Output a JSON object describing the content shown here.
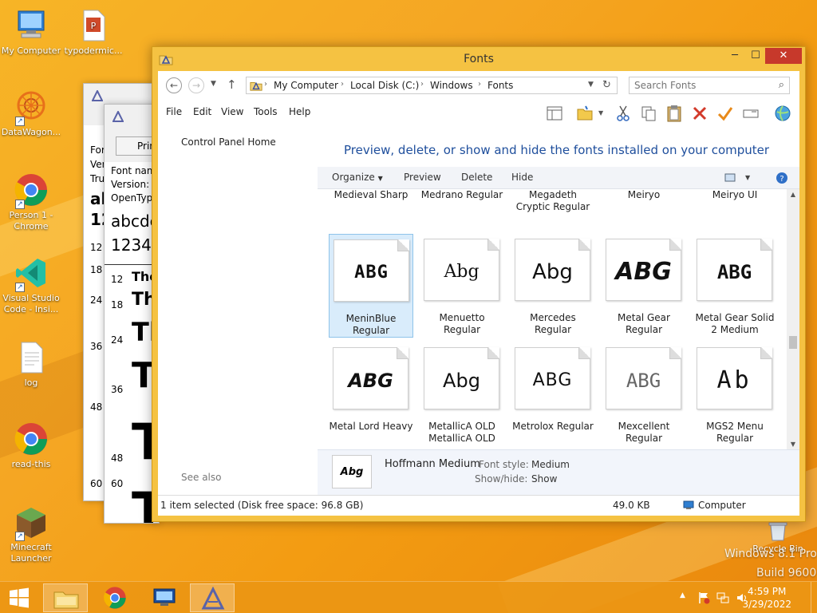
{
  "desktop": {
    "icons": [
      {
        "label": "My Computer"
      },
      {
        "label": "typodermic..."
      },
      {
        "label": "DataWagon..."
      },
      {
        "label": "Person 1 - Chrome"
      },
      {
        "label": "Visual Studio Code - Insi..."
      },
      {
        "label": "log"
      },
      {
        "label": "read-this"
      },
      {
        "label": "Minecraft Launcher"
      },
      {
        "label": "Recycle Bin"
      }
    ],
    "watermark_line1": "Windows 8.1 Pro",
    "watermark_line2": "Build 9600"
  },
  "bg_window": {
    "button": "Print",
    "lines": [
      "Font nam",
      "Version: V",
      "OpenTyp"
    ],
    "sizes": [
      "12",
      "18",
      "24",
      "36",
      "48",
      "60"
    ],
    "left_lines": [
      "For",
      "Ver",
      "Tru"
    ],
    "left_sizes": [
      "12",
      "18",
      "24",
      "36",
      "48",
      "60"
    ],
    "sample_lower": "abcde",
    "sample_digits": "12345",
    "sample_text": "The",
    "sample_left": "al",
    "sample_left_digits": "12"
  },
  "window": {
    "title": "Fonts",
    "breadcrumb": [
      "My Computer",
      "Local Disk (C:)",
      "Windows",
      "Fonts"
    ],
    "search_placeholder": "Search Fonts",
    "menu": [
      "File",
      "Edit",
      "View",
      "Tools",
      "Help"
    ],
    "left_pane": {
      "control_panel_home": "Control Panel Home",
      "see_also": "See also"
    },
    "heading": "Preview, delete, or show and hide the fonts installed on your computer",
    "commands": {
      "organize": "Organize",
      "preview": "Preview",
      "delete": "Delete",
      "hide": "Hide"
    },
    "fonts_top_row": [
      {
        "name": "Medieval Sharp"
      },
      {
        "name": "Medrano Regular"
      },
      {
        "name": "Megadeth Cryptic Regular"
      },
      {
        "name": "Meiryo"
      },
      {
        "name": "Meiryo UI"
      }
    ],
    "fonts_row2": [
      {
        "name": "MeninBlue Regular",
        "sample": "ABG",
        "selected": true
      },
      {
        "name": "Menuetto Regular",
        "sample": "Abg"
      },
      {
        "name": "Mercedes Regular",
        "sample": "Abg"
      },
      {
        "name": "Metal Gear Regular",
        "sample": "ABG"
      },
      {
        "name": "Metal Gear Solid 2 Medium",
        "sample": "ABG"
      }
    ],
    "fonts_row3": [
      {
        "name": "Metal Lord Heavy",
        "sample": "ABG"
      },
      {
        "name": "MetallicA OLD MetallicA OLD",
        "sample": "Abg"
      },
      {
        "name": "Metrolox Regular",
        "sample": "ABG"
      },
      {
        "name": "Mexcellent Regular",
        "sample": "ABG"
      },
      {
        "name": "MGS2 Menu Regular",
        "sample": "Ab"
      }
    ],
    "details": {
      "font_name": "Hoffmann Medium",
      "preview_sample": "Abg",
      "font_style_label": "Font style:",
      "font_style_value": "Medium",
      "showhide_label": "Show/hide:",
      "showhide_value": "Show"
    },
    "status": {
      "selection": "1 item selected (Disk free space: 96.8 GB)",
      "size": "49.0 KB",
      "location": "Computer"
    }
  },
  "taskbar": {
    "time": "4:59 PM",
    "date": "3/29/2022"
  }
}
